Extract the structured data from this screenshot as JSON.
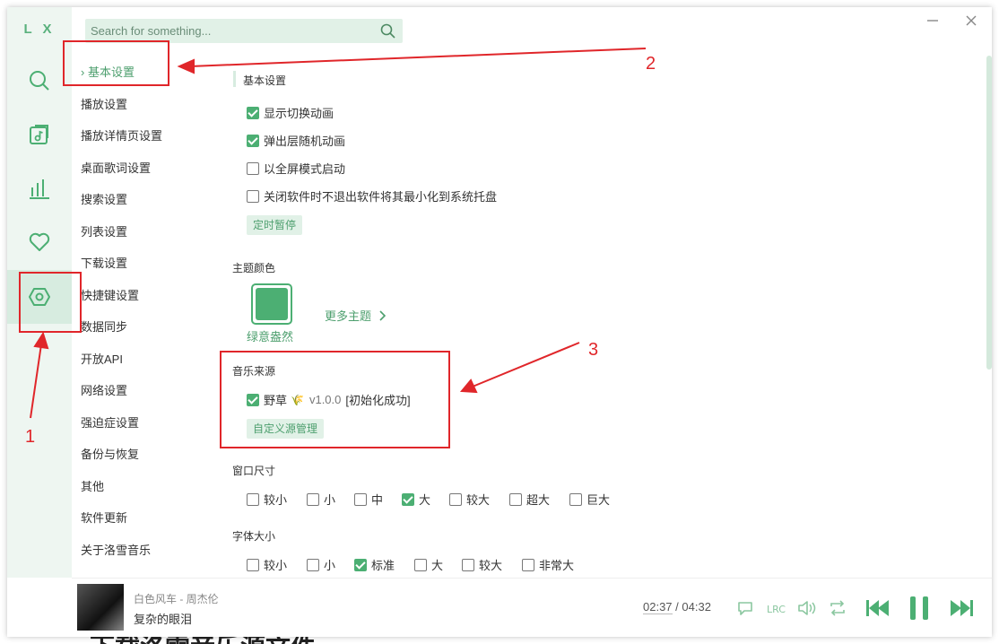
{
  "app": {
    "logo": "L X"
  },
  "search": {
    "placeholder": "Search for something..."
  },
  "menu": [
    "基本设置",
    "播放设置",
    "播放详情页设置",
    "桌面歌词设置",
    "搜索设置",
    "列表设置",
    "下载设置",
    "快捷键设置",
    "数据同步",
    "开放API",
    "网络设置",
    "强迫症设置",
    "备份与恢复",
    "其他",
    "软件更新",
    "关于洛雪音乐"
  ],
  "menu_active_prefix": "›",
  "basic": {
    "title": "基本设置",
    "options": [
      {
        "label": "显示切换动画",
        "checked": true
      },
      {
        "label": "弹出层随机动画",
        "checked": true
      },
      {
        "label": "以全屏模式启动",
        "checked": false
      },
      {
        "label": "关闭软件时不退出软件将其最小化到系统托盘",
        "checked": false
      }
    ],
    "timer_button": "定时暂停"
  },
  "theme": {
    "title": "主题颜色",
    "current": "绿意盎然",
    "more": "更多主题",
    "color": "#4caf73"
  },
  "source": {
    "title": "音乐来源",
    "name": "野草",
    "emoji": "🌾",
    "version": "v1.0.0",
    "status": "[初始化成功]",
    "checked": true,
    "manage_button": "自定义源管理"
  },
  "window_size": {
    "title": "窗口尺寸",
    "options": [
      {
        "label": "较小",
        "checked": false
      },
      {
        "label": "小",
        "checked": false
      },
      {
        "label": "中",
        "checked": false
      },
      {
        "label": "大",
        "checked": true
      },
      {
        "label": "较大",
        "checked": false
      },
      {
        "label": "超大",
        "checked": false
      },
      {
        "label": "巨大",
        "checked": false
      }
    ]
  },
  "font_size": {
    "title": "字体大小",
    "options": [
      {
        "label": "较小",
        "checked": false
      },
      {
        "label": "小",
        "checked": false
      },
      {
        "label": "标准",
        "checked": true
      },
      {
        "label": "大",
        "checked": false
      },
      {
        "label": "较大",
        "checked": false
      },
      {
        "label": "非常大",
        "checked": false
      }
    ]
  },
  "player": {
    "meta": "白色风车 - 周杰伦",
    "title": "复杂的眼泪",
    "current_time": "02:37",
    "separator": "/",
    "total_time": "04:32",
    "lyric_label": "LRC"
  },
  "annotations": {
    "n1": "1",
    "n2": "2",
    "n3": "3"
  },
  "background_text": "下载洛雪音乐源文件",
  "colors": {
    "accent": "#4caf73",
    "annotation": "#e0262a"
  }
}
